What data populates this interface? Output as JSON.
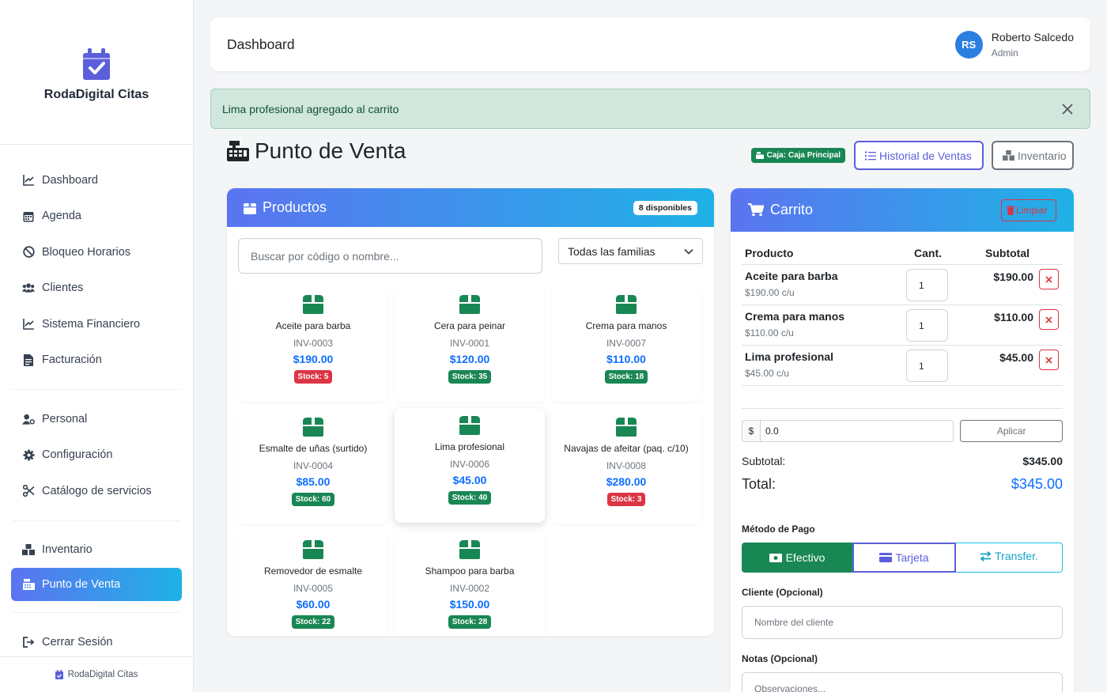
{
  "sidebar": {
    "brand": "RodaDigital Citas",
    "items": [
      {
        "label": "Dashboard",
        "icon": "chart-line-icon"
      },
      {
        "label": "Agenda",
        "icon": "calendar-icon"
      },
      {
        "label": "Bloqueo Horarios",
        "icon": "ban-icon"
      },
      {
        "label": "Clientes",
        "icon": "users-icon"
      },
      {
        "label": "Sistema Financiero",
        "icon": "chart-line-icon"
      },
      {
        "label": "Facturación",
        "icon": "invoice-icon"
      },
      {
        "label": "Personal",
        "icon": "user-gear-icon"
      },
      {
        "label": "Configuración",
        "icon": "gear-icon"
      },
      {
        "label": "Catálogo de servicios",
        "icon": "scissors-icon"
      },
      {
        "label": "Inventario",
        "icon": "boxes-icon"
      },
      {
        "label": "Punto de Venta",
        "icon": "cash-register-icon"
      },
      {
        "label": "Cerrar Sesión",
        "icon": "logout-icon"
      }
    ],
    "active_item": "Punto de Venta",
    "footer": "RodaDigital Citas"
  },
  "header": {
    "title": "Dashboard",
    "user_initials": "RS",
    "user_name": "Roberto Salcedo",
    "user_role": "Admin"
  },
  "alert": {
    "message": "Lima profesional agregado al carrito"
  },
  "page": {
    "title": "Punto de Venta",
    "caja_badge": "Caja: Caja Principal",
    "history_button": "Historial de Ventas",
    "inventory_button": "Inventario"
  },
  "products": {
    "title": "Productos",
    "available_badge": "8 disponibles",
    "search_placeholder": "Buscar por código o nombre...",
    "family_select": "Todas las familias",
    "items": [
      {
        "name": "Aceite para barba",
        "code": "INV-0003",
        "price": "$190.00",
        "stock": "Stock: 5",
        "low": true
      },
      {
        "name": "Cera para peinar",
        "code": "INV-0001",
        "price": "$120.00",
        "stock": "Stock: 35",
        "low": false
      },
      {
        "name": "Crema para manos",
        "code": "INV-0007",
        "price": "$110.00",
        "stock": "Stock: 18",
        "low": false
      },
      {
        "name": "Esmalte de uñas (surtido)",
        "code": "INV-0004",
        "price": "$85.00",
        "stock": "Stock: 60",
        "low": false
      },
      {
        "name": "Lima profesional",
        "code": "INV-0006",
        "price": "$45.00",
        "stock": "Stock: 40",
        "low": false
      },
      {
        "name": "Navajas de afeitar (paq. c/10)",
        "code": "INV-0008",
        "price": "$280.00",
        "stock": "Stock: 3",
        "low": true
      },
      {
        "name": "Removedor de esmalte",
        "code": "INV-0005",
        "price": "$60.00",
        "stock": "Stock: 22",
        "low": false
      },
      {
        "name": "Shampoo para barba",
        "code": "INV-0002",
        "price": "$150.00",
        "stock": "Stock: 28",
        "low": false
      }
    ]
  },
  "cart": {
    "title": "Carrito",
    "clear_button": "Limpiar",
    "columns": [
      "Producto",
      "Cant.",
      "Subtotal"
    ],
    "items": [
      {
        "name": "Aceite para barba",
        "unit": "$190.00 c/u",
        "qty": "1",
        "subtotal": "$190.00"
      },
      {
        "name": "Crema para manos",
        "unit": "$110.00 c/u",
        "qty": "1",
        "subtotal": "$110.00"
      },
      {
        "name": "Lima profesional",
        "unit": "$45.00 c/u",
        "qty": "1",
        "subtotal": "$45.00"
      }
    ],
    "discount_prefix": "$",
    "discount_value": "0.0",
    "apply_button": "Aplicar",
    "subtotal_label": "Subtotal:",
    "subtotal_value": "$345.00",
    "total_label": "Total:",
    "total_value": "$345.00",
    "payment_label": "Método de Pago",
    "payment_methods": [
      "Efectivo",
      "Tarjeta",
      "Transfer."
    ],
    "selected_payment": "Efectivo",
    "client_label": "Cliente (Opcional)",
    "client_placeholder": "Nombre del cliente",
    "notes_label": "Notas (Opcional)",
    "notes_placeholder": "Observaciones..."
  },
  "colors": {
    "accent_start": "#5b74f0",
    "accent_end": "#1fb2e6",
    "success": "#198754",
    "danger": "#dc3545",
    "primary": "#0d6efd"
  }
}
